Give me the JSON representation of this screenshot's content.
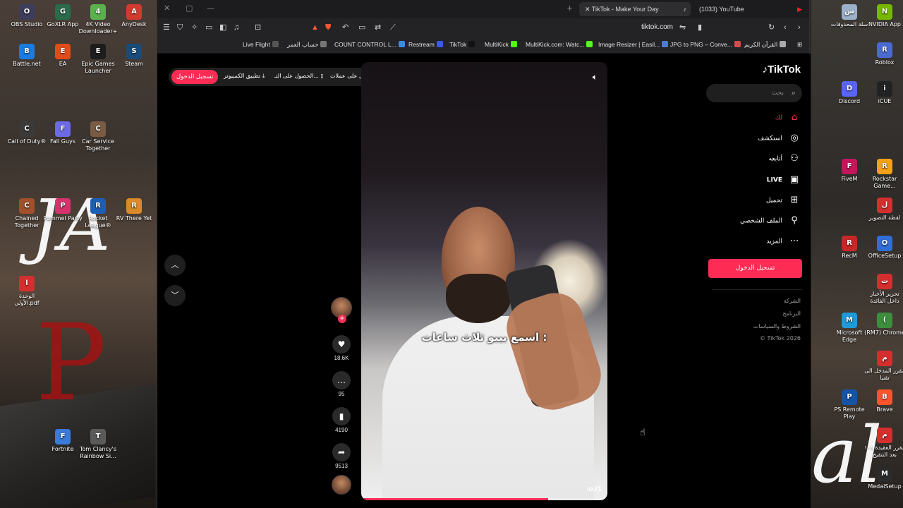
{
  "desktop": {
    "left_icons": [
      {
        "label": "OBS Studio",
        "color": "#3d3d5c"
      },
      {
        "label": "GoXLR App",
        "color": "#2a6b4c"
      },
      {
        "label": "4K Video Downloader+",
        "color": "#5bb14d"
      },
      {
        "label": "AnyDesk",
        "color": "#d33a2f"
      },
      {
        "label": "Battle.net",
        "color": "#1a7be0"
      },
      {
        "label": "EA",
        "color": "#e04c1a"
      },
      {
        "label": "Epic Games Launcher",
        "color": "#1d1d1d"
      },
      {
        "label": "Steam",
        "color": "#1b4b79"
      },
      {
        "label": "Call of Duty®",
        "color": "#3a3a3a"
      },
      {
        "label": "Fall Guys",
        "color": "#6d6ae8"
      },
      {
        "label": "Car Service Together",
        "color": "#7a5c45"
      },
      {
        "label": "Chained Together",
        "color": "#a0502a"
      },
      {
        "label": "Pummel Party",
        "color": "#d6336c"
      },
      {
        "label": "Rocket League®",
        "color": "#1d5fb5"
      },
      {
        "label": "RV There Yet",
        "color": "#d98b2b"
      },
      {
        "label": "الوحدة الأولى.pdf",
        "color": "#d32f2f"
      },
      {
        "label": "Fortnite",
        "color": "#3a7ad9"
      },
      {
        "label": "Tom Clancy's Rainbow Si...",
        "color": "#5a5a5a"
      }
    ],
    "right_icons": [
      {
        "label": "سلة المحذوفات",
        "color": "#9bb0c9"
      },
      {
        "label": "NVIDIA App",
        "color": "#76b900"
      },
      {
        "label": "Roblox",
        "color": "#4b6ad1"
      },
      {
        "label": "Discord",
        "color": "#5865f2"
      },
      {
        "label": "iCUE",
        "color": "#222222"
      },
      {
        "label": "FiveM",
        "color": "#c2185b"
      },
      {
        "label": "Rockstar Game...",
        "color": "#f4a01a"
      },
      {
        "label": "لقطة التصوير",
        "color": "#d32f2f"
      },
      {
        "label": "RecM",
        "color": "#c62828"
      },
      {
        "label": "OfficeSetup",
        "color": "#2f6fd6"
      },
      {
        "label": "تحرير الأخبار داخل الفائدة",
        "color": "#d32f2f"
      },
      {
        "label": "Microsoft Edge",
        "color": "#1d9bd6"
      },
      {
        "label": "(RM7) Chrome",
        "color": "#3c8f3c"
      },
      {
        "label": "مقرر المدخل الى تقنيا",
        "color": "#d32f2f"
      },
      {
        "label": "PS Remote Play",
        "color": "#1453a6"
      },
      {
        "label": "Brave",
        "color": "#fb542b"
      },
      {
        "label": "مقرر العقيدة ١٠١ بعد التنقيح",
        "color": "#d32f2f"
      },
      {
        "label": "MedalSetup",
        "color": "#2b2b2b"
      }
    ]
  },
  "browser": {
    "tabs": [
      {
        "label": "TikTok - Make Your Day",
        "active": true
      },
      {
        "label": "(1033) YouTube",
        "active": false
      }
    ],
    "url": "tiktok.com",
    "bookmarks": [
      "Live Flight",
      "حساب العمر",
      "COUNT CONTROL L...",
      "Restream",
      "TikTok",
      "MultiKick",
      "MultiKick.com: Watc...",
      "Image Resizer | Easil...",
      "JPG to PNG – Conve...",
      "القرآن الكريم"
    ]
  },
  "tiktok": {
    "logo": "TikTok",
    "top_bar": {
      "login": "تسجيل الدخول",
      "get_coins": "احصل على عملات",
      "get_app": "الحصول على التـ...",
      "pc_app": "تطبيق الكمبيوتر"
    },
    "search_placeholder": "بحث",
    "menu": [
      {
        "label": "لك",
        "icon": "home-icon",
        "active": true
      },
      {
        "label": "استكشف",
        "icon": "compass-icon",
        "active": false
      },
      {
        "label": "أتابعه",
        "icon": "following-icon",
        "active": false
      },
      {
        "label": "LIVE",
        "icon": "live-icon",
        "active": false
      },
      {
        "label": "تحميل",
        "icon": "upload-icon",
        "active": false
      },
      {
        "label": "الملف الشخصي",
        "icon": "profile-icon",
        "active": false
      },
      {
        "label": "المزيد",
        "icon": "more-icon",
        "active": false
      }
    ],
    "login_button": "تسجيل الدخول",
    "footer": [
      "الشركة",
      "البرنامج",
      "الشروط والسياسات",
      "© TikTok 2026"
    ],
    "video": {
      "caption": "اسمع بيبو ثلاث ساعات :",
      "watermark": "io.r1",
      "progress": 0.76
    },
    "actions": {
      "likes": "18.6K",
      "comments": "95",
      "saves": "4190",
      "shares": "9513"
    }
  },
  "colors": {
    "accent": "#fe2c55"
  }
}
